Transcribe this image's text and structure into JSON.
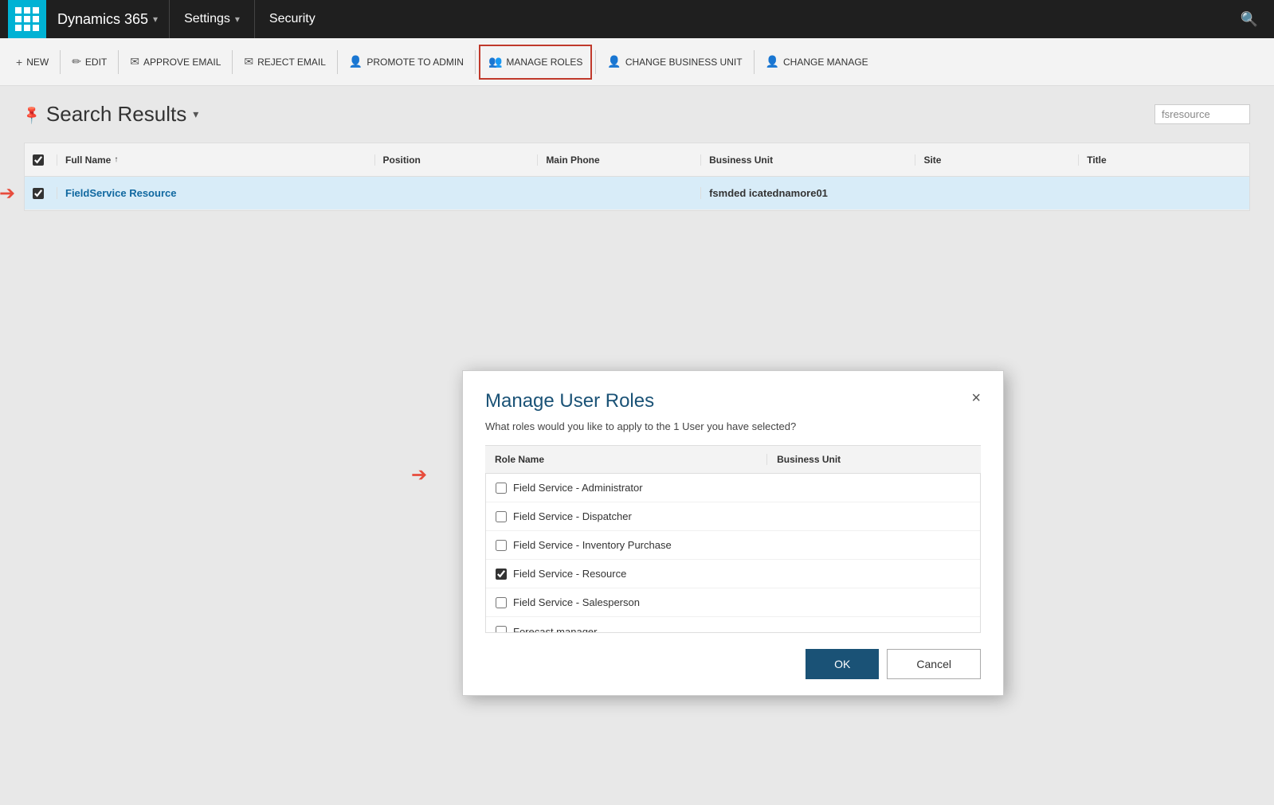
{
  "topnav": {
    "brand": "Dynamics 365",
    "brand_arrow": "▾",
    "settings": "Settings",
    "settings_arrow": "▾",
    "security": "Security"
  },
  "toolbar": {
    "new_label": "NEW",
    "edit_label": "EDIT",
    "approve_email_label": "APPROVE EMAIL",
    "reject_email_label": "REJECT EMAIL",
    "promote_to_admin_label": "PROMOTE TO ADMIN",
    "manage_roles_label": "MANAGE ROLES",
    "change_business_unit_label": "CHANGE BUSINESS UNIT",
    "change_manage_label": "CHANGE MANAGE"
  },
  "search_results": {
    "title": "Search Results",
    "search_placeholder": "fsresource"
  },
  "grid": {
    "headers": {
      "full_name": "Full Name",
      "position": "Position",
      "main_phone": "Main Phone",
      "business_unit": "Business Unit",
      "site": "Site",
      "title": "Title"
    },
    "rows": [
      {
        "name": "FieldService Resource",
        "position": "",
        "main_phone": "",
        "business_unit": "fsmded icatednamore01",
        "site": "",
        "title": ""
      }
    ]
  },
  "modal": {
    "title": "Manage User Roles",
    "subtitle": "What roles would you like to apply to the 1 User you have selected?",
    "table_headers": {
      "role_name": "Role Name",
      "business_unit": "Business Unit"
    },
    "roles": [
      {
        "name": "Field Service - Administrator",
        "checked": false
      },
      {
        "name": "Field Service - Dispatcher",
        "checked": false
      },
      {
        "name": "Field Service - Inventory Purchase",
        "checked": false
      },
      {
        "name": "Field Service - Resource",
        "checked": true
      },
      {
        "name": "Field Service - Salesperson",
        "checked": false
      },
      {
        "name": "Forecast manager",
        "checked": false
      }
    ],
    "ok_label": "OK",
    "cancel_label": "Cancel",
    "close_icon": "×"
  }
}
